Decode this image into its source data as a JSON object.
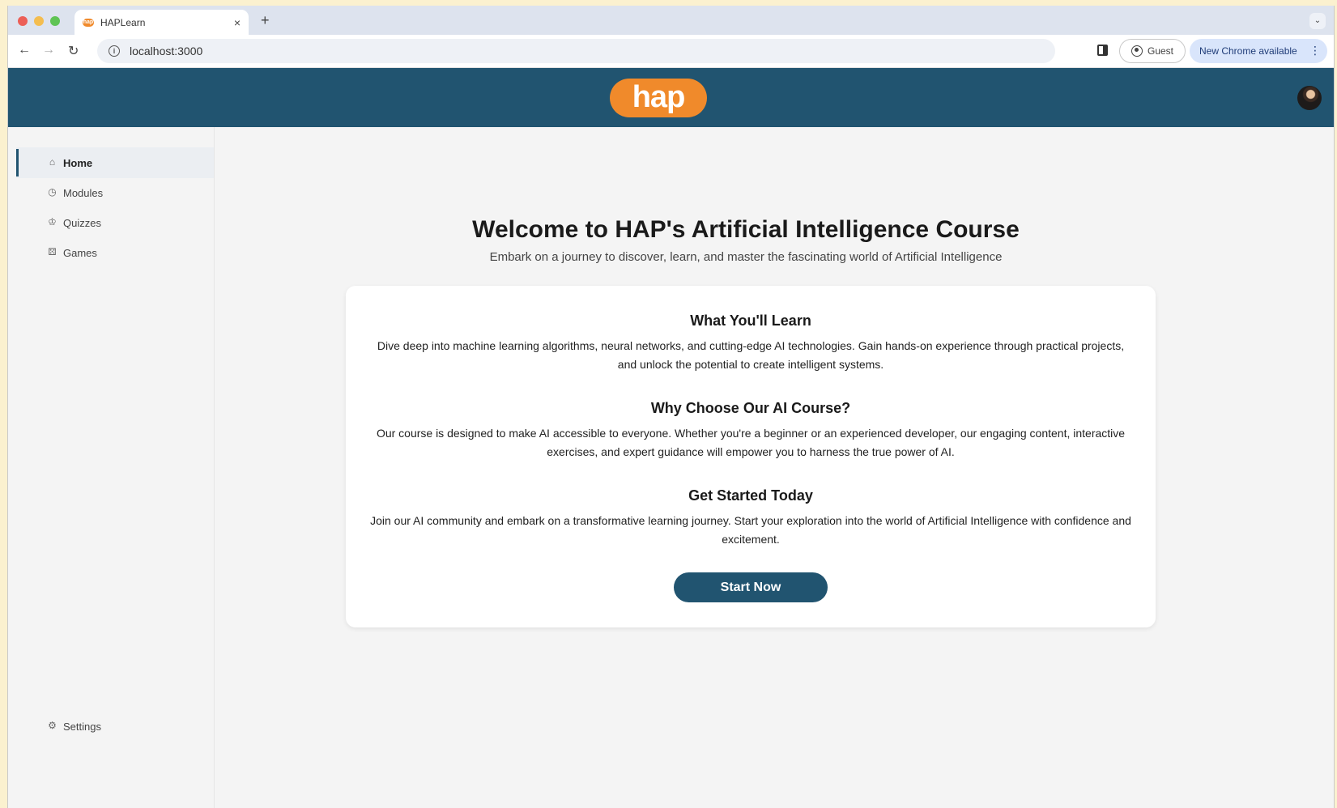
{
  "browser": {
    "tab_title": "HAPLearn",
    "favicon_text": "hap",
    "close_glyph": "×",
    "new_tab_glyph": "+",
    "tab_menu_glyph": "⌄",
    "back_glyph": "←",
    "forward_glyph": "→",
    "reload_glyph": "↻",
    "info_glyph": "i",
    "url": "localhost:3000",
    "guest_label": "Guest",
    "update_label": "New Chrome available",
    "menu_glyph": "⋮"
  },
  "header": {
    "logo_text": "hap",
    "brand_color": "#215470",
    "logo_color": "#f08a2b"
  },
  "sidebar": {
    "items": [
      {
        "label": "Home",
        "icon": "home-icon",
        "glyph": "⌂",
        "active": true
      },
      {
        "label": "Modules",
        "icon": "clock-icon",
        "glyph": "◷",
        "active": false
      },
      {
        "label": "Quizzes",
        "icon": "trophy-icon",
        "glyph": "♔",
        "active": false
      },
      {
        "label": "Games",
        "icon": "gamepad-icon",
        "glyph": "⚄",
        "active": false
      }
    ],
    "settings": {
      "label": "Settings",
      "icon": "gear-icon",
      "glyph": "⚙"
    }
  },
  "main": {
    "title": "Welcome to HAP's Artificial Intelligence Course",
    "subtitle": "Embark on a journey to discover, learn, and master the fascinating world of Artificial Intelligence",
    "sections": [
      {
        "heading": "What You'll Learn",
        "body": "Dive deep into machine learning algorithms, neural networks, and cutting-edge AI technologies. Gain hands-on experience through practical projects, and unlock the potential to create intelligent systems."
      },
      {
        "heading": "Why Choose Our AI Course?",
        "body": "Our course is designed to make AI accessible to everyone. Whether you're a beginner or an experienced developer, our engaging content, interactive exercises, and expert guidance will empower you to harness the true power of AI."
      },
      {
        "heading": "Get Started Today",
        "body": "Join our AI community and embark on a transformative learning journey. Start your exploration into the world of Artificial Intelligence with confidence and excitement."
      }
    ],
    "cta_label": "Start Now"
  }
}
